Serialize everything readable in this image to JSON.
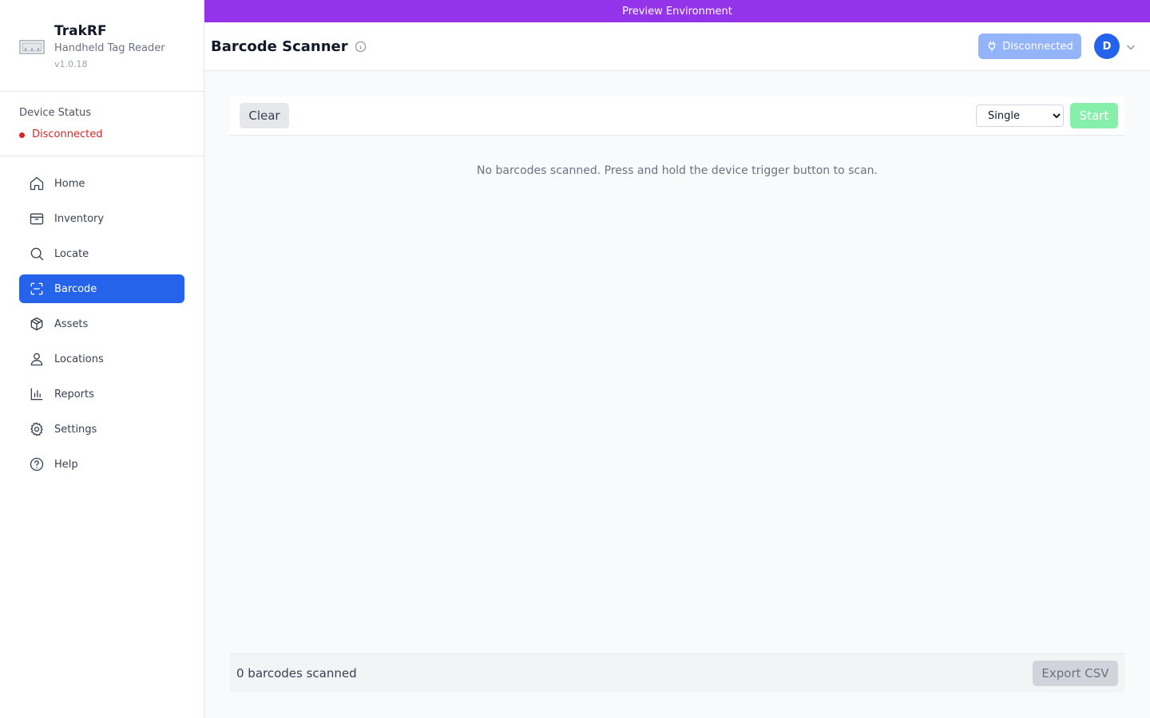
{
  "brand": {
    "title": "TrakRF",
    "subtitle": "Handheld Tag Reader",
    "version": "v1.0.18",
    "logo_icon": "rfid-reader-icon"
  },
  "device_status": {
    "label": "Device Status",
    "value": "Disconnected",
    "color": "#dc2626"
  },
  "nav": {
    "items": [
      {
        "label": "Home",
        "icon": "home-icon",
        "active": false
      },
      {
        "label": "Inventory",
        "icon": "package-icon",
        "active": false
      },
      {
        "label": "Locate",
        "icon": "search-icon",
        "active": false
      },
      {
        "label": "Barcode",
        "icon": "scan-icon",
        "active": true
      },
      {
        "label": "Assets",
        "icon": "cube-icon",
        "active": false
      },
      {
        "label": "Locations",
        "icon": "map-pin-icon",
        "active": false
      },
      {
        "label": "Reports",
        "icon": "bar-chart-icon",
        "active": false
      },
      {
        "label": "Settings",
        "icon": "gear-icon",
        "active": false
      },
      {
        "label": "Help",
        "icon": "help-circle-icon",
        "active": false
      }
    ],
    "active_color": "#2563eb"
  },
  "banner": {
    "text": "Preview Environment",
    "color": "#9333ea"
  },
  "header": {
    "title": "Barcode Scanner",
    "connection_label": "Disconnected",
    "avatar_initial": "D"
  },
  "toolbar": {
    "clear_label": "Clear",
    "mode_selected": "Single",
    "start_label": "Start"
  },
  "main": {
    "empty_message": "No barcodes scanned. Press and hold the device trigger button to scan."
  },
  "footer": {
    "count_text": "0 barcodes scanned",
    "export_label": "Export CSV"
  }
}
